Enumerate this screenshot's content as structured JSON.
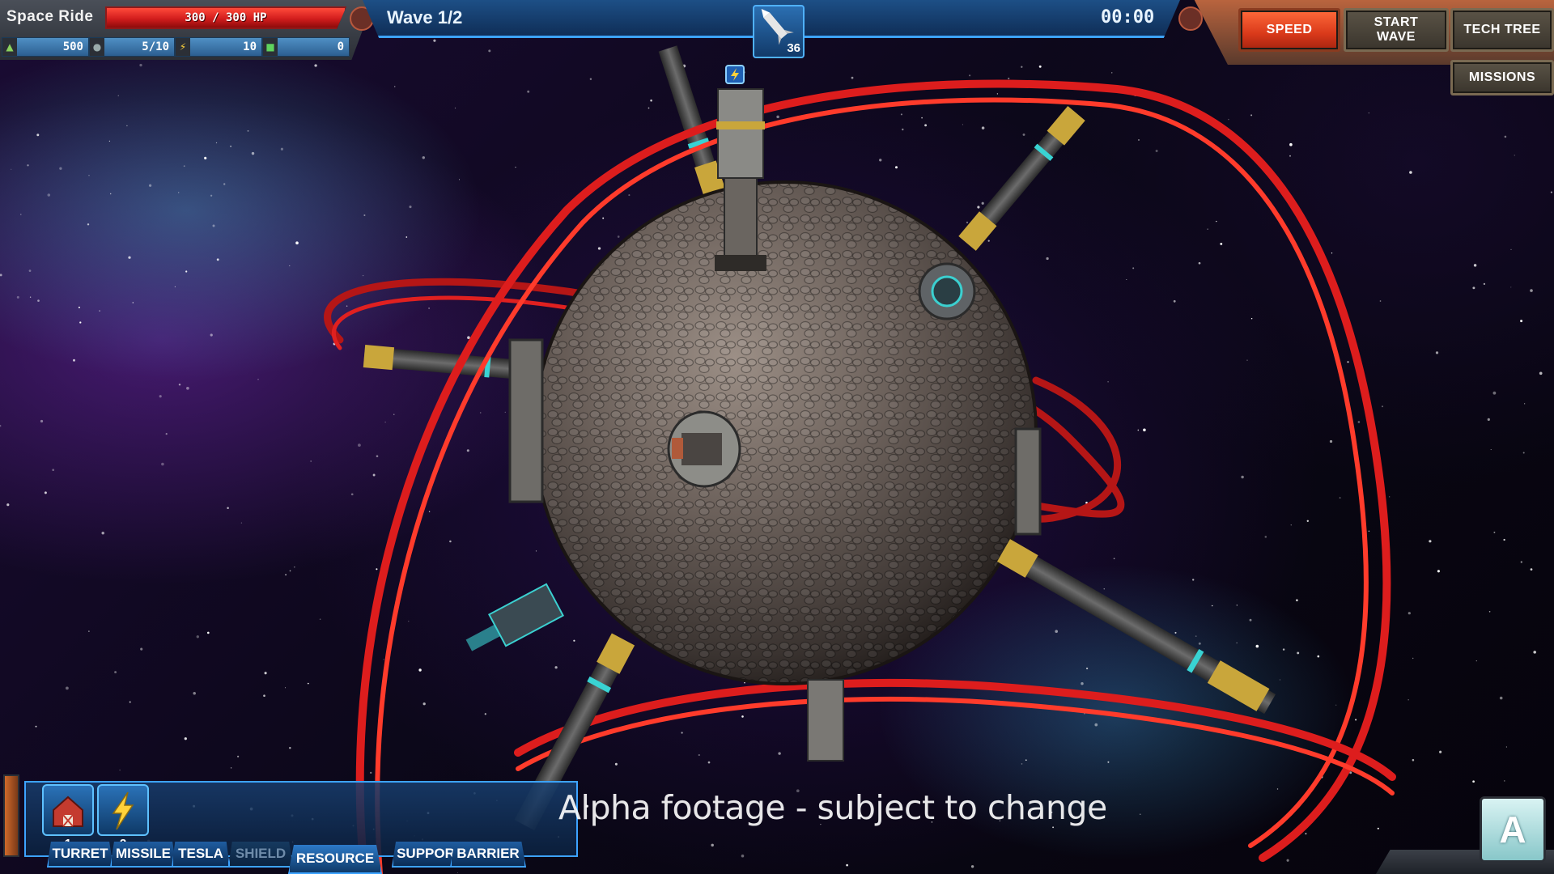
{
  "hud": {
    "level_name": "Space Ride",
    "hp_text": "300 / 300 HP",
    "hp_fraction": 1.0,
    "resources": [
      {
        "icon": "credits-icon",
        "value": "500"
      },
      {
        "icon": "population-icon",
        "value": "5/10"
      },
      {
        "icon": "energy-icon",
        "value": "10"
      },
      {
        "icon": "ore-icon",
        "value": "0"
      }
    ]
  },
  "wave": {
    "label": "Wave 1/2",
    "timer": "00:00",
    "enemy_count": "36",
    "enemy_icon": "rocket-icon"
  },
  "buttons": {
    "speed": "SPEED",
    "start_wave": "START WAVE",
    "tech_tree": "TECH TREE",
    "missions": "MISSIONS"
  },
  "build": {
    "towers": [
      {
        "icon": "barn-icon",
        "hotkey": "1"
      },
      {
        "icon": "lightning-icon",
        "hotkey": "2"
      }
    ],
    "categories": [
      "TURRET",
      "MISSILE",
      "TESLA",
      "SHIELD",
      "RESOURCE",
      "SUPPOR",
      "BARRIER"
    ]
  },
  "overlay": {
    "watermark": "Alpha footage - subject to change",
    "badge_letter": "A"
  },
  "colors": {
    "track": "#d21a1a",
    "hp_fill": "#e02424",
    "hud_blue": "#1d4f86",
    "speed_orange": "#e8502a",
    "accent_cyan": "#3da3ff"
  }
}
